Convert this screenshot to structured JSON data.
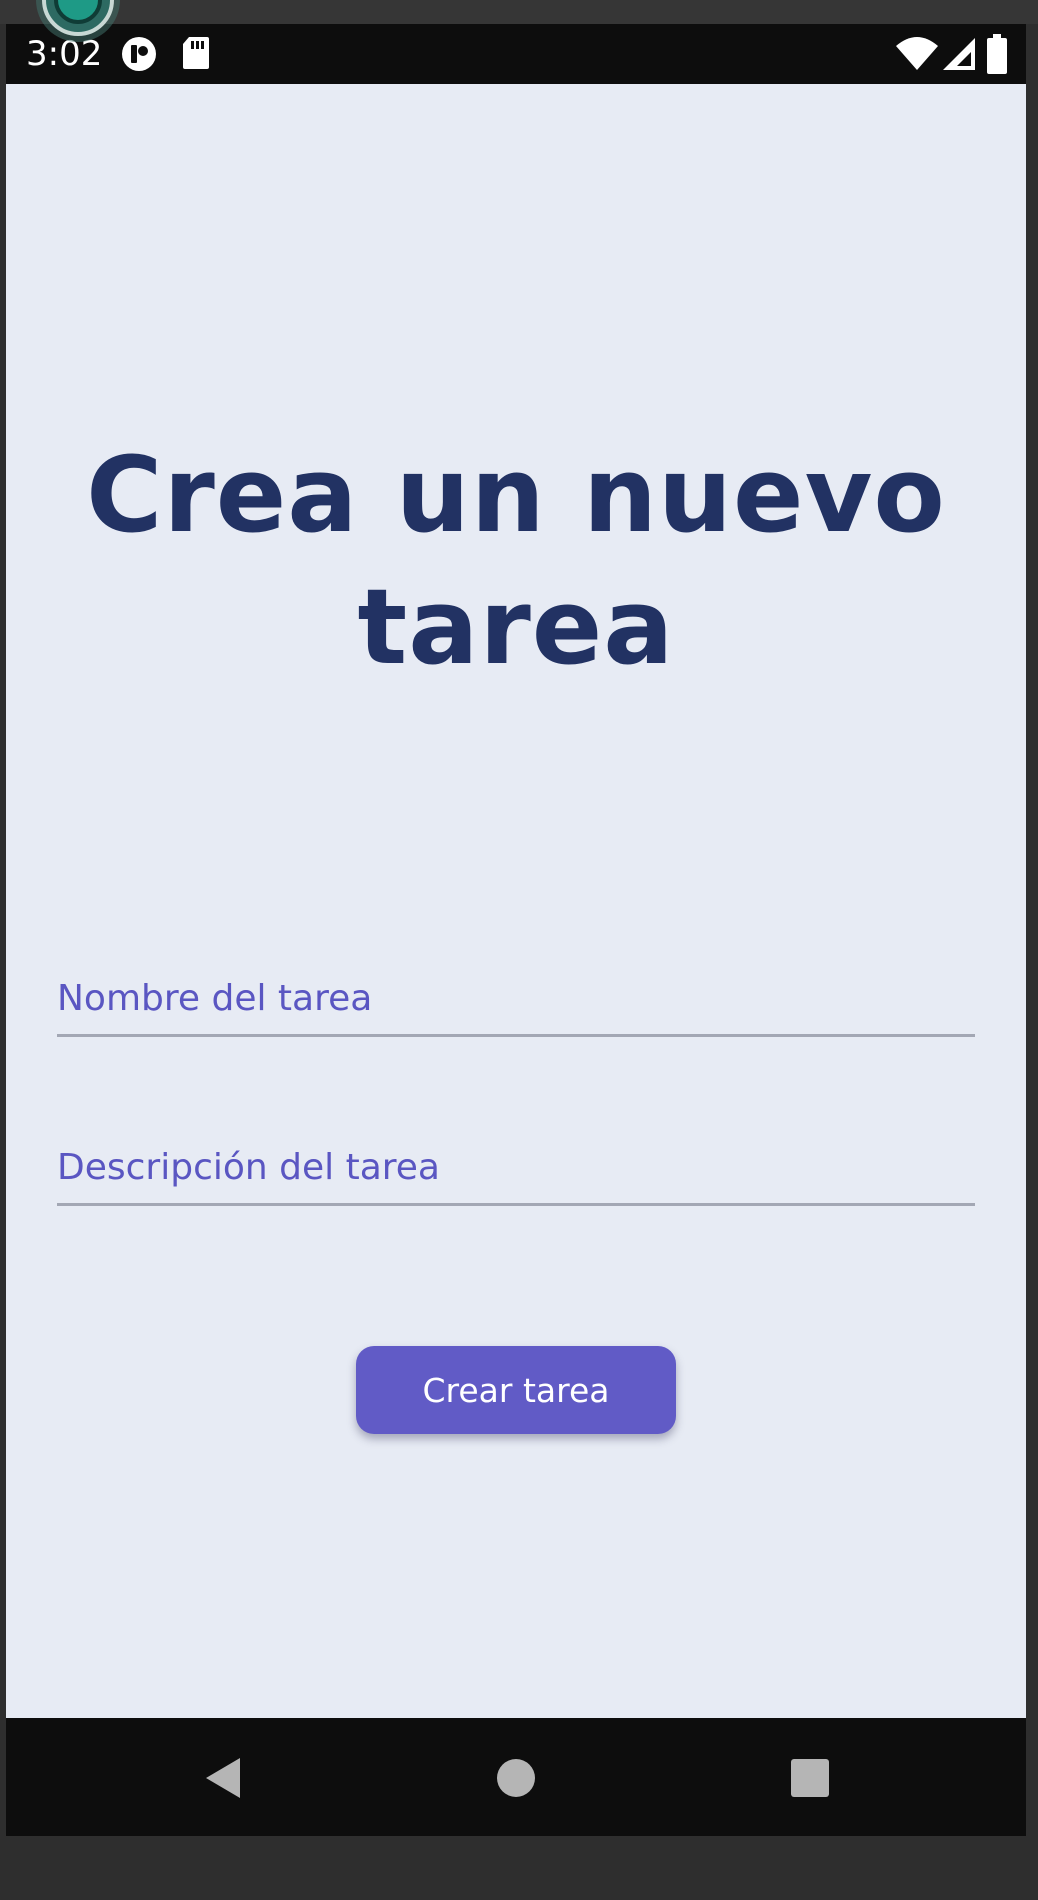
{
  "status_bar": {
    "time": "3:02",
    "left_icons": [
      "record-app-icon",
      "sd-card-icon"
    ],
    "right_icons": [
      "wifi-icon",
      "cell-signal-icon",
      "battery-icon"
    ]
  },
  "screen": {
    "title": "Crea un nuevo tarea",
    "background_color": "#e7ebf4",
    "title_color": "#223263"
  },
  "form": {
    "name_field": {
      "value": "",
      "placeholder": "Nombre del tarea"
    },
    "description_field": {
      "value": "",
      "placeholder": "Descripción del tarea"
    },
    "submit_label": "Crear tarea",
    "accent_color": "#615bc6"
  },
  "nav_bar": {
    "buttons": [
      "back-icon",
      "home-icon",
      "recents-icon"
    ]
  }
}
